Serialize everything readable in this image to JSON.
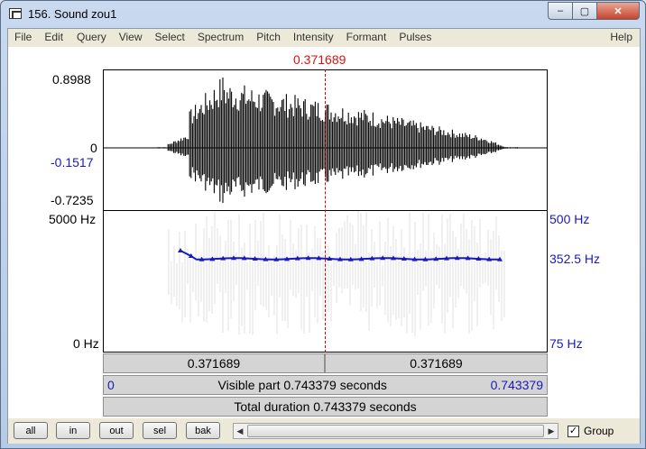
{
  "window": {
    "title": "156. Sound zou1"
  },
  "menu": {
    "items": [
      "File",
      "Edit",
      "Query",
      "View",
      "Select",
      "Spectrum",
      "Pitch",
      "Intensity",
      "Formant",
      "Pulses"
    ],
    "help": "Help"
  },
  "cursor": {
    "time": "0.371689"
  },
  "waveform": {
    "max": "0.8988",
    "zero": "0",
    "cursor_value": "-0.1517",
    "min": "-0.7235"
  },
  "spectrogram": {
    "freq_max": "5000 Hz",
    "freq_min": "0 Hz"
  },
  "pitch": {
    "max": "500 Hz",
    "cursor_value": "352.5 Hz",
    "min": "75 Hz"
  },
  "time_bar": {
    "left": "0.371689",
    "right": "0.371689"
  },
  "visible_bar": {
    "start": "0",
    "label": "Visible part 0.743379 seconds",
    "end": "0.743379"
  },
  "total_bar": {
    "label": "Total duration 0.743379 seconds"
  },
  "buttons": {
    "all": "all",
    "in": "in",
    "out": "out",
    "sel": "sel",
    "bak": "bak"
  },
  "group": {
    "label": "Group",
    "checked": true
  },
  "colors": {
    "pitch": "#1a1ab8",
    "cursor": "#dd1111",
    "signal": "#000000"
  }
}
